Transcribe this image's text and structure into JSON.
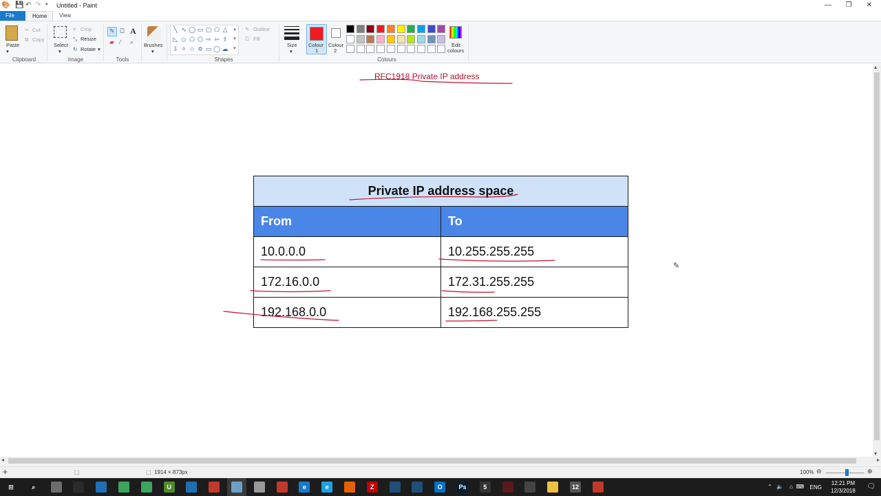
{
  "window": {
    "title": "Untitled - Paint",
    "minimize": "—",
    "restore": "❐",
    "close": "✕"
  },
  "tabs": [
    "File",
    "Home",
    "View"
  ],
  "ribbon": {
    "clipboard": {
      "paste": "Paste",
      "cut": "Cut",
      "copy": "Copy",
      "label": "Clipboard"
    },
    "image": {
      "select": "Select",
      "crop": "Crop",
      "resize": "Resize",
      "rotate": "Rotate",
      "label": "Image"
    },
    "tools": {
      "text_glyph": "A",
      "label": "Tools"
    },
    "brushes": {
      "label": "Brushes"
    },
    "shapes": {
      "outline": "Outline",
      "fill": "Fill",
      "label": "Shapes"
    },
    "size": {
      "label": "Size"
    },
    "colours": {
      "colour1": "Colour 1",
      "colour1_line1": "Colour",
      "colour1_line2": "1",
      "colour2_line1": "Colour",
      "colour2_line2": "2",
      "edit_line1": "Edit",
      "edit_line2": "colours",
      "label": "Colours",
      "colour1_value": "#ed1c24",
      "colour2_value": "#ffffff",
      "palette_row1": [
        "#000000",
        "#7f7f7f",
        "#880015",
        "#ed1c24",
        "#ff7f27",
        "#fff200",
        "#22b14c",
        "#00a2e8",
        "#3f48cc",
        "#a349a4"
      ],
      "palette_row2": [
        "#ffffff",
        "#c3c3c3",
        "#b97a57",
        "#ffaec9",
        "#ffc90e",
        "#efe4b0",
        "#b5e61d",
        "#99d9ea",
        "#7092be",
        "#c8bfe7"
      ],
      "palette_row3": [
        "#ffffff",
        "#ffffff",
        "#ffffff",
        "#ffffff",
        "#ffffff",
        "#ffffff",
        "#ffffff",
        "#ffffff",
        "#ffffff",
        "#ffffff"
      ]
    }
  },
  "canvas": {
    "heading": "RFC1918 Private IP address",
    "table": {
      "caption": "Private IP address space",
      "headers": [
        "From",
        "To"
      ],
      "rows": [
        [
          "10.0.0.0",
          "10.255.255.255"
        ],
        [
          "172.16.0.0",
          "172.31.255.255"
        ],
        [
          "192.168.0.0",
          "192.168.255.255"
        ]
      ]
    }
  },
  "statusbar": {
    "canvas_size": "1914 × 873px",
    "zoom": "100%"
  },
  "taskbar": {
    "language": "ENG",
    "time": "12:21 PM",
    "date": "12/3/2018",
    "apps": [
      {
        "name": "start-icon",
        "glyph": "⊞",
        "color": "#1c1c1c"
      },
      {
        "name": "search-icon",
        "glyph": "⌕",
        "color": "#1c1c1c"
      },
      {
        "name": "app-icon-1",
        "glyph": "",
        "color": "#6d6d6d"
      },
      {
        "name": "terminal-icon",
        "glyph": "",
        "color": "#2a2a2a"
      },
      {
        "name": "app-icon-2",
        "glyph": "",
        "color": "#1f6fb5"
      },
      {
        "name": "app-icon-3",
        "glyph": "",
        "color": "#3aa55d"
      },
      {
        "name": "app-icon-4",
        "glyph": "",
        "color": "#3aa55d"
      },
      {
        "name": "app-icon-5",
        "glyph": "U",
        "color": "#4c8c2b"
      },
      {
        "name": "app-icon-6",
        "glyph": "",
        "color": "#1f6fb5"
      },
      {
        "name": "app-icon-7",
        "glyph": "",
        "color": "#c0392b"
      },
      {
        "name": "paint-app-icon",
        "glyph": "",
        "color": "#6aa0c8"
      },
      {
        "name": "app-icon-8",
        "glyph": "",
        "color": "#999999"
      },
      {
        "name": "app-icon-9",
        "glyph": "",
        "color": "#c0392b"
      },
      {
        "name": "edge-icon",
        "glyph": "e",
        "color": "#1979ca"
      },
      {
        "name": "ie-icon",
        "glyph": "e",
        "color": "#1ba1e2"
      },
      {
        "name": "firefox-icon",
        "glyph": "",
        "color": "#e66000"
      },
      {
        "name": "filezilla-icon",
        "glyph": "Z",
        "color": "#bf0000"
      },
      {
        "name": "app-icon-10",
        "glyph": "",
        "color": "#1f4e79"
      },
      {
        "name": "app-icon-11",
        "glyph": "",
        "color": "#1f4e79"
      },
      {
        "name": "outlook-icon",
        "glyph": "O",
        "color": "#0072c6"
      },
      {
        "name": "photoshop-icon",
        "glyph": "Ps",
        "color": "#001e36"
      },
      {
        "name": "app-icon-12",
        "glyph": "5",
        "color": "#333333"
      },
      {
        "name": "app-icon-13",
        "glyph": "",
        "color": "#5a1a1a"
      },
      {
        "name": "app-icon-14",
        "glyph": "",
        "color": "#444444"
      },
      {
        "name": "file-explorer-icon",
        "glyph": "",
        "color": "#f0c040"
      },
      {
        "name": "app-icon-15",
        "glyph": "12",
        "color": "#555555"
      },
      {
        "name": "app-icon-16",
        "glyph": "",
        "color": "#c0392b"
      }
    ]
  }
}
